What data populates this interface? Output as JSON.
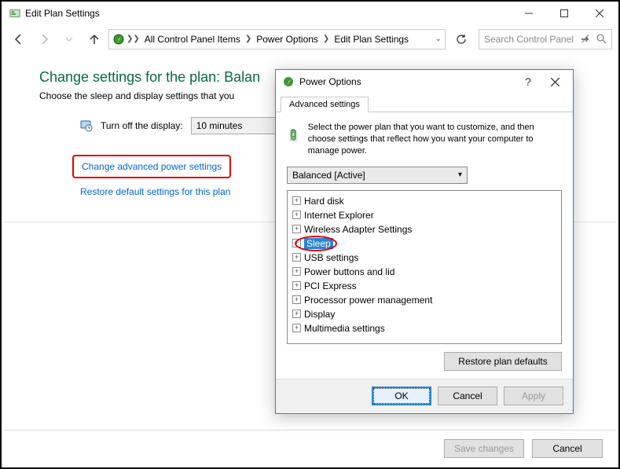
{
  "window": {
    "title": "Edit Plan Settings"
  },
  "breadcrumb": {
    "seg1": "All Control Panel Items",
    "seg2": "Power Options",
    "seg3": "Edit Plan Settings"
  },
  "search": {
    "placeholder": "Search Control Panel"
  },
  "page": {
    "heading_prefix": "Change settings for the plan: ",
    "heading_plan": "Balan",
    "description": "Choose the sleep and display settings that you",
    "turn_off_label": "Turn off the display:",
    "turn_off_value": "10 minutes",
    "link_advanced": "Change advanced power settings",
    "link_restore": "Restore default settings for this plan",
    "save_btn": "Save changes",
    "cancel_btn": "Cancel"
  },
  "dialog": {
    "title": "Power Options",
    "tab": "Advanced settings",
    "intro": "Select the power plan that you want to customize, and then choose settings that reflect how you want your computer to manage power.",
    "plan_selected": "Balanced [Active]",
    "tree": [
      "Hard disk",
      "Internet Explorer",
      "Wireless Adapter Settings",
      "Sleep",
      "USB settings",
      "Power buttons and lid",
      "PCI Express",
      "Processor power management",
      "Display",
      "Multimedia settings"
    ],
    "selected_index": 3,
    "restore_btn": "Restore plan defaults",
    "ok": "OK",
    "cancel": "Cancel",
    "apply": "Apply"
  }
}
